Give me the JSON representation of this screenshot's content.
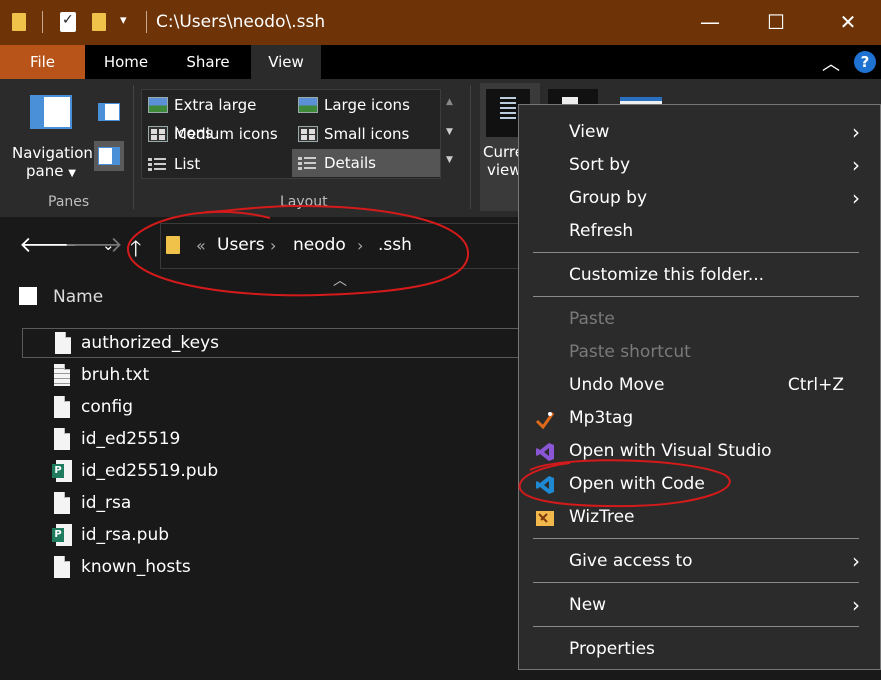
{
  "window": {
    "title": "C:\\Users\\neodo\\.ssh",
    "minimize": "—",
    "maximize": "☐",
    "close": "✕"
  },
  "tabs": [
    {
      "label": "File"
    },
    {
      "label": "Home"
    },
    {
      "label": "Share"
    },
    {
      "label": "View"
    }
  ],
  "ribbon": {
    "navigation_pane": {
      "line1": "Navigation",
      "line2": "pane"
    },
    "panes_group": "Panes",
    "layout_group": "Layout",
    "layout_items": [
      {
        "label": "Extra large icons"
      },
      {
        "label": "Large icons"
      },
      {
        "label": "Medium icons"
      },
      {
        "label": "Small icons"
      },
      {
        "label": "List"
      },
      {
        "label": "Details"
      }
    ],
    "current_view": {
      "line1": "Curre",
      "line2": "view"
    }
  },
  "address": {
    "overflow": "«",
    "crumbs": [
      "Users",
      "neodo",
      ".ssh"
    ]
  },
  "files": {
    "column_name": "Name",
    "items": [
      {
        "name": "authorized_keys",
        "icon": "document-icon"
      },
      {
        "name": "bruh.txt",
        "icon": "text-file-icon"
      },
      {
        "name": "config",
        "icon": "document-icon"
      },
      {
        "name": "id_ed25519",
        "icon": "document-icon"
      },
      {
        "name": "id_ed25519.pub",
        "icon": "publisher-file-icon"
      },
      {
        "name": "id_rsa",
        "icon": "document-icon"
      },
      {
        "name": "id_rsa.pub",
        "icon": "publisher-file-icon"
      },
      {
        "name": "known_hosts",
        "icon": "document-icon"
      }
    ]
  },
  "context_menu": {
    "view": "View",
    "sort_by": "Sort by",
    "group_by": "Group by",
    "refresh": "Refresh",
    "customize": "Customize this folder...",
    "paste": "Paste",
    "paste_shortcut": "Paste shortcut",
    "undo_move": "Undo Move",
    "undo_shortcut": "Ctrl+Z",
    "mp3tag": "Mp3tag",
    "open_vs": "Open with Visual Studio",
    "open_code": "Open with Code",
    "wiztree": "WizTree",
    "give_access": "Give access to",
    "new": "New",
    "properties": "Properties"
  },
  "colors": {
    "titlebar": "#6e3408",
    "file_tab": "#b8541a",
    "annotation": "#d41a1a",
    "vscode_blue": "#1f8ad2"
  }
}
